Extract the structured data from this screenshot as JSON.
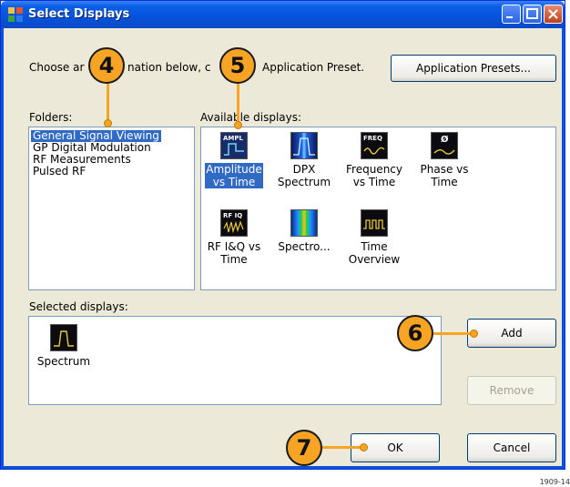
{
  "window": {
    "title": "Select Displays",
    "colors": {
      "title_bar": "#0a5fe6",
      "selection": "#316ac5",
      "callout": "#f7a323"
    }
  },
  "intro_text_left": "Choose ar",
  "intro_text_mid": "nation below, c",
  "intro_text_right": "Application Preset.",
  "presets_button": "Application Presets...",
  "folders": {
    "label": "Folders:",
    "items": [
      "General Signal Viewing",
      "GP Digital Modulation",
      "RF Measurements",
      "Pulsed RF"
    ],
    "selected_index": 0
  },
  "available": {
    "label": "Available displays:",
    "tiles": [
      {
        "icon_text": "AMPL",
        "caption": "Amplitude\nvs Time",
        "icon": "amplitude-vs-time-icon"
      },
      {
        "icon_text": "",
        "caption": "DPX\nSpectrum",
        "icon": "dpx-spectrum-icon"
      },
      {
        "icon_text": "FREQ",
        "caption": "Frequency\nvs Time",
        "icon": "frequency-vs-time-icon"
      },
      {
        "icon_text": "Ø",
        "caption": "Phase vs\nTime",
        "icon": "phase-vs-time-icon"
      },
      {
        "icon_text": "RF IQ",
        "caption": "RF I&Q vs\nTime",
        "icon": "rf-iq-vs-time-icon"
      },
      {
        "icon_text": "",
        "caption": "Spectro...",
        "icon": "spectrogram-icon"
      },
      {
        "icon_text": "",
        "caption": "Time\nOverview",
        "icon": "time-overview-icon"
      }
    ]
  },
  "selected": {
    "label": "Selected displays:",
    "items": [
      {
        "caption": "Spectrum",
        "icon": "spectrum-icon"
      }
    ]
  },
  "buttons": {
    "add": "Add",
    "remove": "Remove",
    "ok": "OK",
    "cancel": "Cancel"
  },
  "callouts": [
    "4",
    "5",
    "6",
    "7"
  ],
  "figure_number": "1909-14"
}
